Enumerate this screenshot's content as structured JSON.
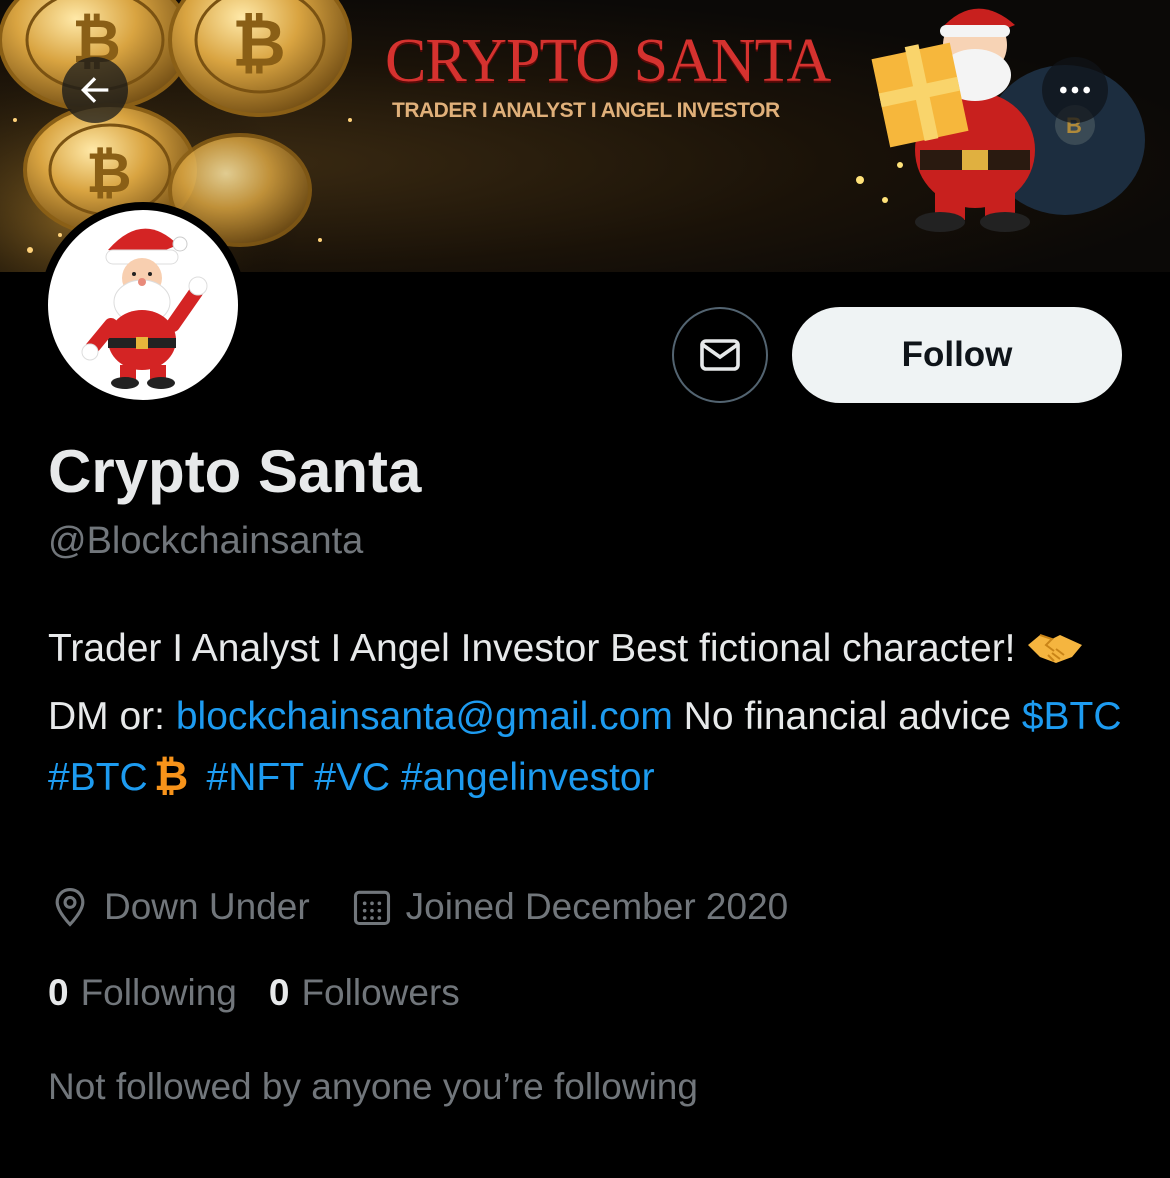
{
  "banner": {
    "title": "CRYPTO SANTA",
    "subtitle": "TRADER I ANALYST I ANGEL INVESTOR"
  },
  "header": {
    "back_icon": "arrow-left-icon",
    "more_icon": "more-horizontal-icon"
  },
  "actions": {
    "message_icon": "envelope-icon",
    "follow_label": "Follow"
  },
  "profile": {
    "display_name": "Crypto Santa",
    "handle": "@Blockchainsanta",
    "bio": {
      "part1": "Trader I Analyst I Angel Investor Best fictional character! ",
      "part2": "DM or: ",
      "email": "blockchainsanta@gmail.com",
      "part3": " No financial advice ",
      "cashtag_btc": "$BTC",
      "hashtag_btc": "#BTC",
      "hashtag_nft": "#NFT",
      "hashtag_vc": "#VC",
      "hashtag_angel": "#angelinvestor"
    },
    "location": "Down Under",
    "joined": "Joined December 2020"
  },
  "stats": {
    "following_count": "0",
    "following_label": "Following",
    "followers_count": "0",
    "followers_label": "Followers"
  },
  "not_followed_text": "Not followed by anyone you’re following",
  "colors": {
    "background": "#000000",
    "text_primary": "#e7e9ea",
    "text_secondary": "#71767b",
    "link": "#1d9bf0",
    "follow_button_bg": "#eff3f4",
    "banner_title": "#d5322f",
    "bitcoin_orange": "#f7931a"
  }
}
